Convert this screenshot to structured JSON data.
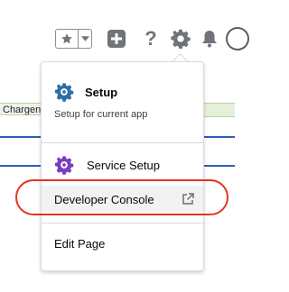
{
  "header": {
    "icons": [
      "star-icon",
      "chevron-down-icon",
      "add-icon",
      "help-icon",
      "gear-icon",
      "bell-icon",
      "avatar"
    ]
  },
  "background": {
    "chip_text": "Chargen"
  },
  "menu": {
    "setup": {
      "title": "Setup",
      "subtitle": "Setup for current app",
      "icon": "gear-icon"
    },
    "service_setup": {
      "label": "Service Setup",
      "icon": "gear-icon"
    },
    "developer_console": {
      "label": "Developer Console",
      "icon": "external-link-icon"
    },
    "edit_page": {
      "label": "Edit Page"
    }
  },
  "colors": {
    "setup_gear": "#2a6fa8",
    "service_gear": "#7b3cc0",
    "highlight": "#e8321e",
    "header_icon": "#6f7479"
  }
}
